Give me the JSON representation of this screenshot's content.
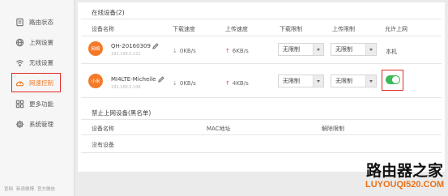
{
  "colors": {
    "accent": "#f07a26",
    "toggle_on": "#3cb95a",
    "avatar": "#f47a2a",
    "upload_arrow": "#e53935",
    "highlight": "#e02b27"
  },
  "sidebar": {
    "items": [
      {
        "label": "路由状态",
        "icon": "router-status-icon",
        "active": false
      },
      {
        "label": "上网设置",
        "icon": "globe-icon",
        "active": false
      },
      {
        "label": "无线设置",
        "icon": "wifi-icon",
        "active": false
      },
      {
        "label": "网速控制",
        "icon": "speedometer-icon",
        "active": true
      },
      {
        "label": "更多功能",
        "icon": "grid-icon",
        "active": false
      },
      {
        "label": "系统管理",
        "icon": "gear-icon",
        "active": false
      }
    ],
    "footer_links": [
      "官网",
      "新浪微博",
      "官方微信"
    ]
  },
  "online": {
    "title": "在线设备(2)",
    "headers": [
      "设备名称",
      "下载速度",
      "上传速度",
      "下载限制",
      "上传限制",
      "允许上网"
    ],
    "devices": [
      {
        "avatar_text": "网络",
        "name": "QH-20160309",
        "ip": "192.168.0.121",
        "download": "0KB/s",
        "upload": "6KB/s",
        "download_limit": "无限制",
        "upload_limit": "无限制",
        "allow_label": "本机"
      },
      {
        "avatar_text": "小米",
        "name": "MI4LTE-Micheile",
        "ip": "192.168.0.108",
        "download": "0KB/s",
        "upload": "4KB/s",
        "download_limit": "无限制",
        "upload_limit": "无限制",
        "allow_internet": true
      }
    ]
  },
  "blacklist": {
    "title": "禁止上网设备(黑名单)",
    "headers": [
      "设备名称",
      "MAC地址",
      "解除限制"
    ],
    "empty_text": "没有设备"
  },
  "watermark": {
    "title": "路由器之家",
    "url": "LUYOUQI520.COM"
  }
}
